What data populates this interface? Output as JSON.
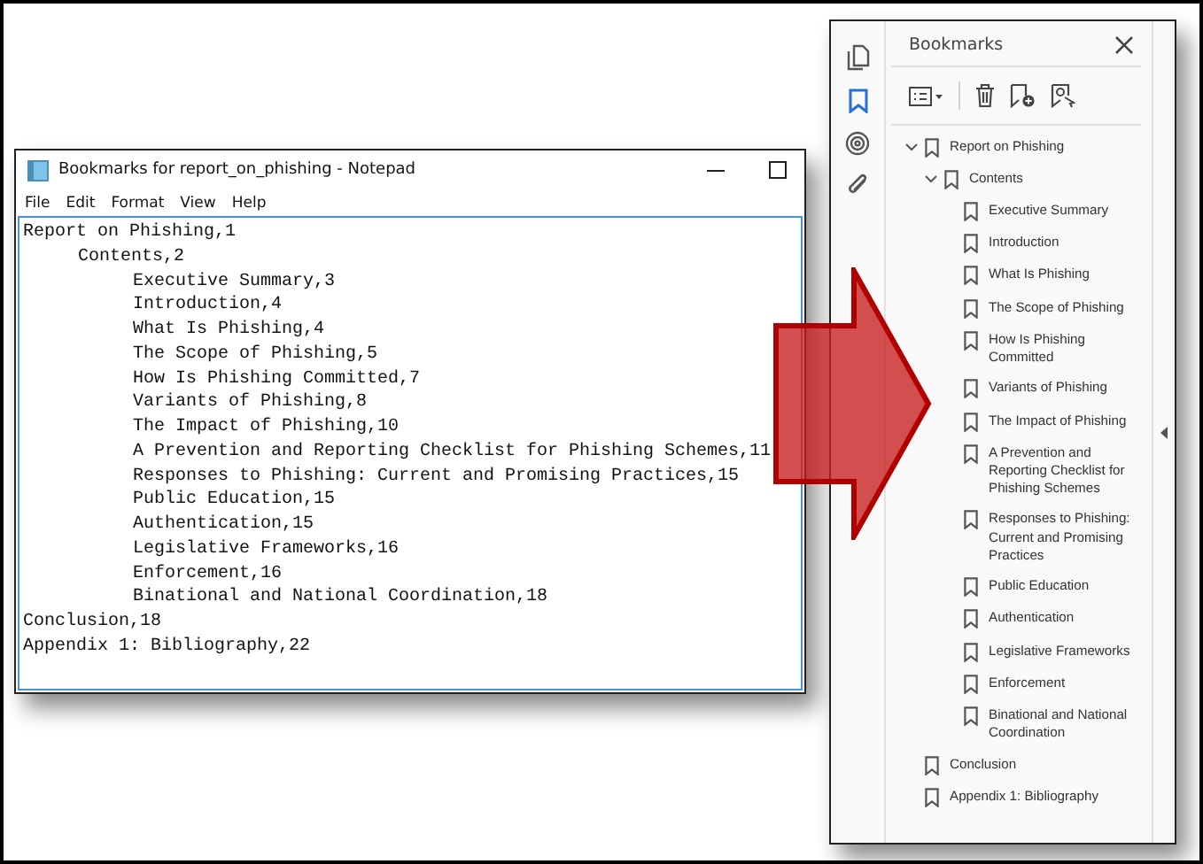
{
  "notepad": {
    "title": "Bookmarks for report_on_phishing - Notepad",
    "menu": [
      "File",
      "Edit",
      "Format",
      "View",
      "Help"
    ],
    "lines": [
      {
        "text": "Report on Phishing,1",
        "children": [
          {
            "text": "Contents,2",
            "children": [
              {
                "text": "Executive Summary,3"
              },
              {
                "text": "Introduction,4"
              },
              {
                "text": "What Is Phishing,4"
              },
              {
                "text": "The Scope of Phishing,5"
              },
              {
                "text": "How Is Phishing Committed,7"
              },
              {
                "text": "Variants of Phishing,8"
              },
              {
                "text": "The Impact of Phishing,10"
              },
              {
                "text": "A Prevention and Reporting Checklist for Phishing Schemes,11"
              },
              {
                "text": "Responses to Phishing: Current and Promising Practices,15"
              },
              {
                "text": "Public Education,15"
              },
              {
                "text": "Authentication,15"
              },
              {
                "text": "Legislative Frameworks,16"
              },
              {
                "text": "Enforcement,16"
              },
              {
                "text": "Binational and National Coordination,18"
              }
            ]
          }
        ]
      },
      {
        "text": "Conclusion,18"
      },
      {
        "text": "Appendix 1: Bibliography,22"
      }
    ]
  },
  "bookmarks_panel": {
    "title": "Bookmarks",
    "tools": [
      {
        "selected": false
      },
      {
        "selected": true
      },
      {
        "selected": false
      },
      {
        "selected": false
      }
    ],
    "tree": [
      {
        "label": "Report on Phishing",
        "expanded": true,
        "children": [
          {
            "label": "Contents",
            "expanded": true,
            "children": [
              {
                "label": "Executive Summary"
              },
              {
                "label": "Introduction"
              },
              {
                "label": "What Is Phishing"
              },
              {
                "label": "The Scope of Phishing"
              },
              {
                "label": "How Is Phishing Committed"
              },
              {
                "label": "Variants of Phishing"
              },
              {
                "label": "The Impact of Phishing"
              },
              {
                "label": "A Prevention and Reporting Checklist for Phishing Schemes"
              },
              {
                "label": "Responses to Phishing: Current and Promising Practices"
              },
              {
                "label": "Public Education"
              },
              {
                "label": "Authentication"
              },
              {
                "label": "Legislative Frameworks"
              },
              {
                "label": "Enforcement"
              },
              {
                "label": "Binational and National Coordination"
              }
            ]
          }
        ]
      },
      {
        "label": "Conclusion"
      },
      {
        "label": "Appendix 1: Bibliography"
      }
    ]
  }
}
